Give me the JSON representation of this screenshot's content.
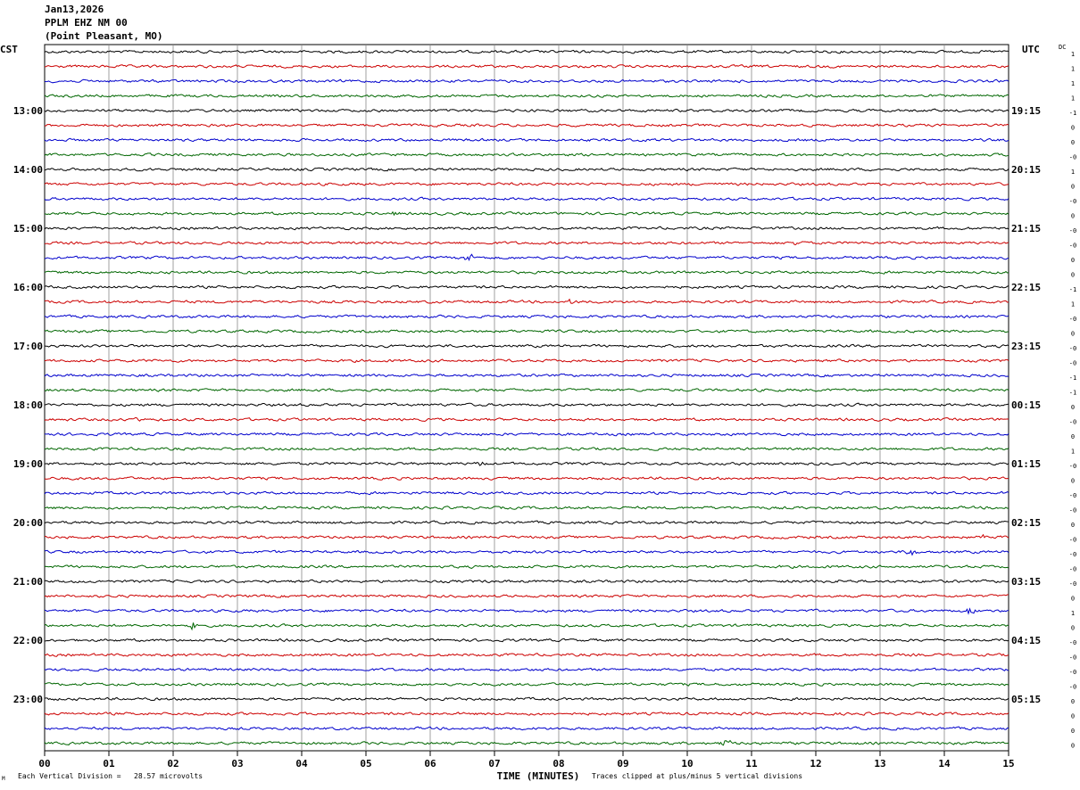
{
  "header": {
    "date": "Jan13,2026",
    "station": "PPLM EHZ NM 00",
    "location": "(Point Pleasant, MO)"
  },
  "left_zone": "CST",
  "right_zone": "UTC",
  "dc_label": "DC",
  "footer": {
    "scale_text": "Each Vertical Division =   28.57 microvolts",
    "clip_text": "Traces clipped at plus/minus 5 vertical divisions",
    "corner_mark": "M"
  },
  "colors": {
    "cycle": [
      "#000000",
      "#cc0000",
      "#0000cc",
      "#006600"
    ],
    "grid": "#888888"
  },
  "chart_data": {
    "type": "line",
    "title": "Jan13,2026 PPLM EHZ NM 00 (Point Pleasant, MO)",
    "xlabel": "TIME (MINUTES)",
    "x_ticks": [
      "00",
      "01",
      "02",
      "03",
      "04",
      "05",
      "06",
      "07",
      "08",
      "09",
      "10",
      "11",
      "12",
      "13",
      "14",
      "15"
    ],
    "xlim": [
      0,
      15
    ],
    "traces_per_hour": 4,
    "trace_count": 48,
    "left_hour_labels": [
      "13:00",
      "14:00",
      "15:00",
      "16:00",
      "17:00",
      "18:00",
      "19:00",
      "20:00",
      "21:00",
      "22:00",
      "23:00"
    ],
    "right_hour_labels": [
      "19:15",
      "20:15",
      "21:15",
      "22:15",
      "23:15",
      "00:15",
      "01:15",
      "02:15",
      "03:15",
      "04:15",
      "05:15"
    ],
    "dc_offsets": [
      "1",
      "1",
      "1",
      "1",
      "-1",
      "0",
      "0",
      "-0",
      "1",
      "0",
      "-0",
      "0",
      "-0",
      "-0",
      "0",
      "0",
      "-1",
      "1",
      "-0",
      "0",
      "-0",
      "-0",
      "-1",
      "-1",
      "0",
      "-0",
      "0",
      "1",
      "-0",
      "0",
      "-0",
      "-0",
      "0",
      "-0",
      "-0",
      "-0",
      "-0",
      "0",
      "1",
      "0",
      "-0",
      "-0",
      "-0",
      "-0",
      "0",
      "0",
      "0",
      "0"
    ],
    "event_markers": [
      {
        "trace": 11,
        "minute": 5.5,
        "amp": 5
      },
      {
        "trace": 13,
        "minute": 11.7,
        "amp": 5
      },
      {
        "trace": 14,
        "minute": 6.6,
        "amp": 6
      },
      {
        "trace": 17,
        "minute": 8.2,
        "amp": 5
      },
      {
        "trace": 25,
        "minute": 1.4,
        "amp": 4
      },
      {
        "trace": 28,
        "minute": 6.8,
        "amp": 4
      },
      {
        "trace": 33,
        "minute": 14.6,
        "amp": 5
      },
      {
        "trace": 34,
        "minute": 13.5,
        "amp": 5
      },
      {
        "trace": 36,
        "minute": 12.3,
        "amp": 4
      },
      {
        "trace": 39,
        "minute": 2.3,
        "amp": 7
      },
      {
        "trace": 38,
        "minute": 14.4,
        "amp": 5
      },
      {
        "trace": 47,
        "minute": 10.6,
        "amp": 6
      }
    ]
  }
}
